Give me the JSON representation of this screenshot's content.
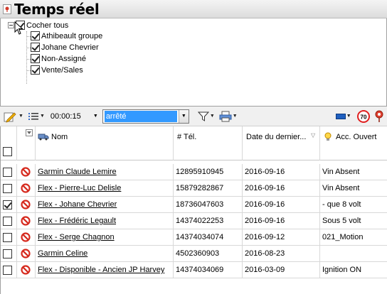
{
  "window": {
    "title": "Temps réel"
  },
  "tree": {
    "root_label": "Cocher tous",
    "items": [
      {
        "label": "Athibeault groupe",
        "checked": true
      },
      {
        "label": "Johane Chevrier",
        "checked": true
      },
      {
        "label": "Non-Assigné",
        "checked": true
      },
      {
        "label": "Vente/Sales",
        "checked": true
      }
    ]
  },
  "toolbar": {
    "interval": "00:00:15",
    "status_filter": "arrêté",
    "icons": [
      "edit-icon",
      "list-icon",
      "filter-icon",
      "print-icon",
      "color-icon",
      "speed-limit-icon",
      "map-pin-icon"
    ],
    "speed_limit_value": "70"
  },
  "grid": {
    "columns": [
      "Nom",
      "# Tél.",
      "Date du dernier...",
      "Acc. Ouvert"
    ],
    "rows": [
      {
        "checked": false,
        "name": "Garmin Claude Lemire",
        "phone": "12895910945",
        "date": "2016-09-16",
        "acc": "Vin Absent"
      },
      {
        "checked": false,
        "name": "Flex - Pierre-Luc Delisle",
        "phone": "15879282867",
        "date": "2016-09-16",
        "acc": "Vin Absent"
      },
      {
        "checked": true,
        "name": "Flex - Johane Chevrier",
        "phone": "18736047603",
        "date": "2016-09-16",
        "acc": "- que 8 volt"
      },
      {
        "checked": false,
        "name": "Flex - Frédéric Legault",
        "phone": "14374022253",
        "date": "2016-09-16",
        "acc": "Sous 5 volt"
      },
      {
        "checked": false,
        "name": "Flex - Serge Chagnon",
        "phone": "14374034074",
        "date": "2016-09-12",
        "acc": "021_Motion"
      },
      {
        "checked": false,
        "name": "Garmin Celine",
        "phone": "4502360903",
        "date": "2016-08-23",
        "acc": ""
      },
      {
        "checked": false,
        "name": "Flex - Disponible - Ancien JP Harvey",
        "phone": "14374034069",
        "date": "2016-03-09",
        "acc": "Ignition ON"
      }
    ]
  }
}
